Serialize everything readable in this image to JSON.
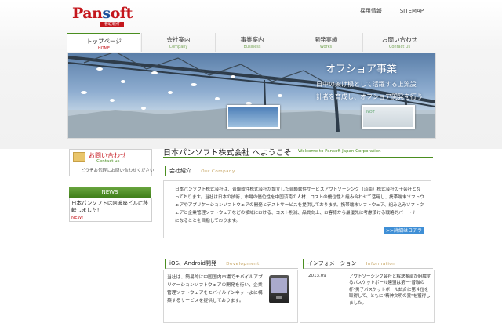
{
  "header": {
    "logo_text": "Pansoft",
    "logo_sub": "普联软件",
    "links": [
      "採用情報",
      "SITEMAP"
    ]
  },
  "nav": [
    {
      "label": "トップページ",
      "en": "HOME",
      "active": true
    },
    {
      "label": "会社案内",
      "en": "Company"
    },
    {
      "label": "事業案内",
      "en": "Business"
    },
    {
      "label": "開発実績",
      "en": "Works"
    },
    {
      "label": "お問い合わせ",
      "en": "Contact Us"
    }
  ],
  "banner": {
    "title": "オフショア事業",
    "line1": "日中の架け橋として活躍する上流設",
    "line2": "計者を育成し、オフショア開発を行う",
    "thumb2_text": "NOT"
  },
  "contact": {
    "title": "お問い合わせ",
    "en": "Contact us",
    "desc": "どうぞお気軽にお問い合わせください"
  },
  "news": {
    "heading": "NEWS",
    "item": "日本パンソフトは阿波座ビルに移転しました！",
    "badge": "NEW!"
  },
  "main": {
    "welcome_title": "日本パンソフト株式会社 へようこそ",
    "welcome_en": "Welcome to Pansoft Japan Corporation",
    "company": {
      "heading": "会社紹介",
      "heading_en": "Our Company",
      "text": "日本パンソフト株式会社は、普聯軟件株式会社が設立した普聯軟件サービスアウトソーシング（済南）株式会社の子会社となっております。当社は日本の技術、市場の優位性を中国済南の人材、コストの優位性と組み合わせて活用し、携帯端末ソフトウェアやアプリケーションソフトウェアの開発とテストサービスを提供しております。携帯端末ソフトウェア、組み込みソフトウェアと企業管理ソフトウェアなどの領域における、コスト削減、品質向上、お客様から最優先に考慮頂ける戦略的パートナーになることを目指しております。",
      "more": ">>詳細はコチラ"
    },
    "dev": {
      "heading": "iOS、Android開発",
      "heading_en": "Development",
      "text": "当社は、簡易的に中国国内市場でモバイルアプリケーションソフトウェアの開発を行い、企業管理ソフトウェアをモバイルインネットよに構築するサービスを提供しております。"
    },
    "info": {
      "heading": "インフォメーション",
      "heading_en": "Information",
      "date": "2013.09",
      "text": "アウトソーシング会社と解決案部が組織するバスケットボール連盟は第一\"普聯の杯\"男子バスケットボール試合に第４位を取得して、ともに\"精神文明の賞\"を獲得しました。"
    }
  },
  "colors": {
    "brand_red": "#c4161c",
    "accent_green": "#4a8e1f",
    "button_blue": "#3f8fd6"
  }
}
